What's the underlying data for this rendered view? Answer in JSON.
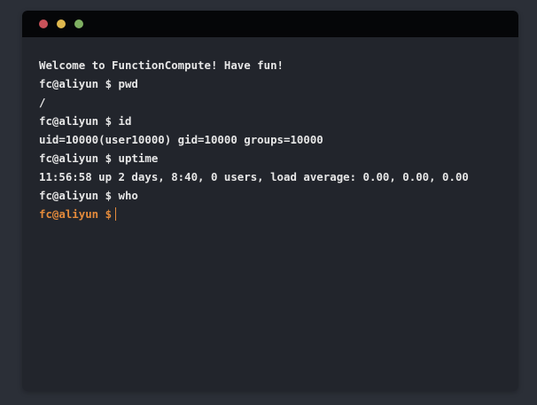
{
  "window": {
    "buttons": {
      "close_color": "#c9525a",
      "minimize_color": "#e0b84e",
      "maximize_color": "#7fb062"
    }
  },
  "terminal": {
    "lines": [
      "Welcome to FunctionCompute! Have fun!",
      "fc@aliyun $ pwd",
      "/",
      "fc@aliyun $ id",
      "uid=10000(user10000) gid=10000 groups=10000",
      "fc@aliyun $ uptime",
      "11:56:58 up 2 days, 8:40, 0 users, load average: 0.00, 0.00, 0.00",
      "fc@aliyun $ who"
    ],
    "prompt": "fc@aliyun $",
    "input_value": "",
    "prompt_color": "#e38a3b"
  }
}
